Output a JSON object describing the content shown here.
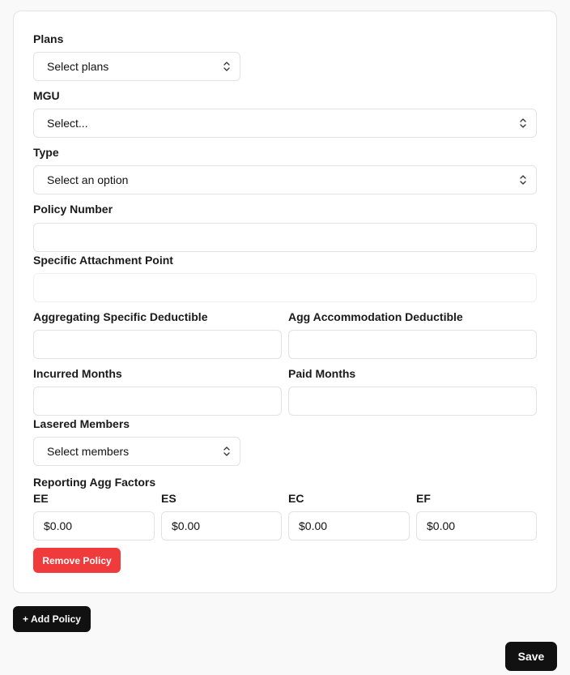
{
  "form": {
    "plans": {
      "label": "Plans",
      "value": "Select plans"
    },
    "mgu": {
      "label": "MGU",
      "value": "Select..."
    },
    "type": {
      "label": "Type",
      "value": "Select an option"
    },
    "policy_number": {
      "label": "Policy Number",
      "value": ""
    },
    "specific_attachment_point": {
      "label": "Specific Attachment Point",
      "value": ""
    },
    "aggregating_specific_deductible": {
      "label": "Aggregating Specific Deductible",
      "value": ""
    },
    "agg_accommodation_deductible": {
      "label": "Agg Accommodation Deductible",
      "value": ""
    },
    "incurred_months": {
      "label": "Incurred Months",
      "value": ""
    },
    "paid_months": {
      "label": "Paid Months",
      "value": ""
    },
    "lasered_members": {
      "label": "Lasered Members",
      "value": "Select members"
    },
    "reporting_agg_factors": {
      "label": "Reporting Agg Factors",
      "ee": {
        "label": "EE",
        "value": "$0.00"
      },
      "es": {
        "label": "ES",
        "value": "$0.00"
      },
      "ec": {
        "label": "EC",
        "value": "$0.00"
      },
      "ef": {
        "label": "EF",
        "value": "$0.00"
      }
    },
    "remove_policy_label": "Remove Policy"
  },
  "actions": {
    "add_policy_label": "+ Add Policy",
    "save_label": "Save"
  },
  "icons": {
    "select_chevron": "chevron-up-down-icon"
  }
}
